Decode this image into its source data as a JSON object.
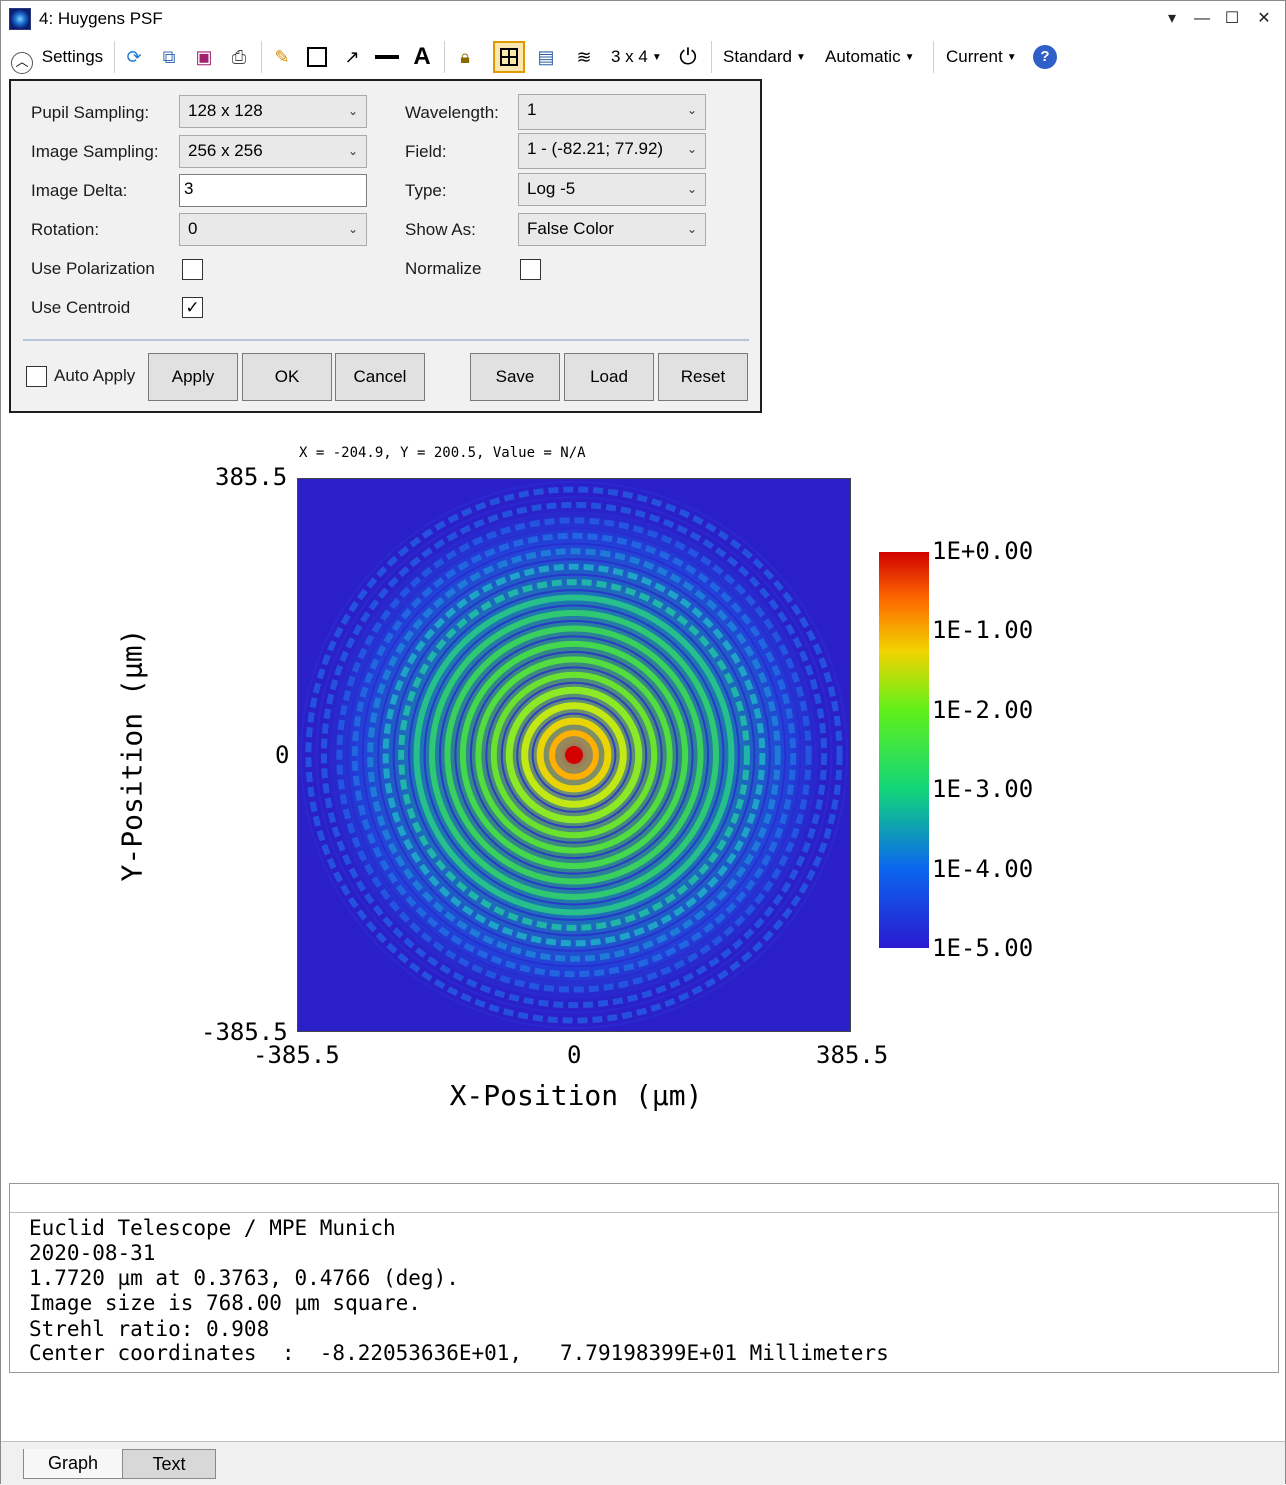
{
  "window": {
    "title": "4: Huygens PSF",
    "controls": [
      "▾",
      "—",
      "☐",
      "✕"
    ]
  },
  "toolbar": {
    "settings_label": "Settings",
    "layout_label": "3 x 4",
    "standard_label": "Standard",
    "automatic_label": "Automatic",
    "current_label": "Current",
    "icons": [
      "refresh-icon",
      "copy-icon",
      "save-image-icon",
      "print-icon",
      "pencil-icon",
      "rectangle-icon",
      "arrow-icon",
      "line-icon",
      "text-icon",
      "lock-icon",
      "grid-icon",
      "window-icon",
      "layers-icon",
      "clock-icon",
      "help-icon"
    ]
  },
  "settings": {
    "pupil_sampling_label": "Pupil Sampling:",
    "pupil_sampling_value": "128 x 128",
    "image_sampling_label": "Image Sampling:",
    "image_sampling_value": "256 x 256",
    "image_delta_label": "Image Delta:",
    "image_delta_value": "3",
    "rotation_label": "Rotation:",
    "rotation_value": "0",
    "use_polarization_label": "Use Polarization",
    "use_polarization_checked": false,
    "use_centroid_label": "Use Centroid",
    "use_centroid_checked": true,
    "wavelength_label": "Wavelength:",
    "wavelength_value": "1",
    "field_label": "Field:",
    "field_value": "1 - (-82.21; 77.92)",
    "type_label": "Type:",
    "type_value": "Log -5",
    "show_as_label": "Show As:",
    "show_as_value": "False Color",
    "normalize_label": "Normalize",
    "normalize_checked": false,
    "auto_apply_label": "Auto Apply",
    "auto_apply_checked": false,
    "buttons": {
      "apply": "Apply",
      "ok": "OK",
      "cancel": "Cancel",
      "save": "Save",
      "load": "Load",
      "reset": "Reset"
    }
  },
  "plot": {
    "coord_readout": "X = -204.9, Y = 200.5, Value = N/A",
    "x_ticks": [
      "-385.5",
      "0",
      "385.5"
    ],
    "y_ticks": [
      "385.5",
      "0",
      "-385.5"
    ],
    "xlabel": "X-Position (µm)",
    "ylabel": "Y-Position (µm)",
    "colorbar_labels": [
      "1E+0.00",
      "1E-1.00",
      "1E-2.00",
      "1E-3.00",
      "1E-4.00",
      "1E-5.00"
    ]
  },
  "chart_data": {
    "type": "heatmap",
    "title": "",
    "xlabel": "X-Position (µm)",
    "ylabel": "Y-Position (µm)",
    "xlim": [
      -385.5,
      385.5
    ],
    "ylim": [
      -385.5,
      385.5
    ],
    "x_ticks": [
      -385.5,
      0,
      385.5
    ],
    "y_ticks": [
      -385.5,
      0,
      385.5
    ],
    "colorbar": {
      "scale": "log",
      "min": 1e-05,
      "max": 1,
      "tick_labels": [
        "1E+0.00",
        "1E-1.00",
        "1E-2.00",
        "1E-3.00",
        "1E-4.00",
        "1E-5.00"
      ],
      "colormap": [
        "#2a1ad0",
        "#0b66ee",
        "#12d67a",
        "#5ff01a",
        "#f2d400",
        "#ff6a00",
        "#d00000"
      ]
    },
    "peak": {
      "x": 0,
      "y": 0,
      "value": 1
    },
    "description_rings": "concentric Airy diffraction rings centered at origin"
  },
  "text_panel": {
    "lines": [
      "Euclid Telescope / MPE Munich",
      "2020-08-31",
      "1.7720 µm at 0.3763, 0.4766 (deg).",
      "Image size is 768.00 µm square.",
      "Strehl ratio: 0.908",
      "Center coordinates  :  -8.22053636E+01,   7.79198399E+01 Millimeters"
    ]
  },
  "tabs": {
    "graph": "Graph",
    "text": "Text"
  }
}
